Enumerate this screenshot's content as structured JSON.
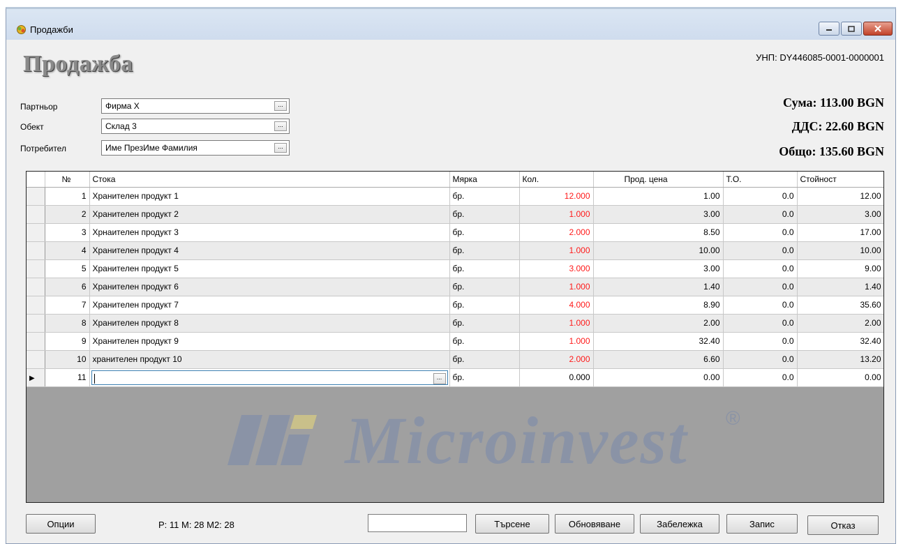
{
  "window": {
    "title": "Продажби",
    "controls": {
      "minimize": "minimize-icon",
      "maximize": "maximize-icon",
      "close": "close-icon"
    }
  },
  "header": {
    "title": "Продажба",
    "unp": "УНП: DY446085-0001-0000001"
  },
  "fields": [
    {
      "label": "Партньор",
      "value": "Фирма Х"
    },
    {
      "label": "Обект",
      "value": "Склад 3"
    },
    {
      "label": "Потребител",
      "value": "Име ПрезИме Фамилия"
    }
  ],
  "field_button": "...",
  "totals": {
    "sum": "Сума: 113.00 BGN",
    "vat": "ДДС: 22.60 BGN",
    "total": "Общо: 135.60 BGN"
  },
  "table": {
    "columns": [
      "№",
      "Стока",
      "Мярка",
      "Кол.",
      "Прод. цена",
      "Т.О.",
      "Стойност"
    ],
    "rows": [
      {
        "no": "1",
        "item": "Хранителен продукт 1",
        "unit": "бр.",
        "qty": "12.000",
        "price": "1.00",
        "to": "0.0",
        "value": "12.00"
      },
      {
        "no": "2",
        "item": "Хранителен продукт 2",
        "unit": "бр.",
        "qty": "1.000",
        "price": "3.00",
        "to": "0.0",
        "value": "3.00"
      },
      {
        "no": "3",
        "item": "Хрнаителен продукт 3",
        "unit": "бр.",
        "qty": "2.000",
        "price": "8.50",
        "to": "0.0",
        "value": "17.00"
      },
      {
        "no": "4",
        "item": "Хранителен продукт 4",
        "unit": "бр.",
        "qty": "1.000",
        "price": "10.00",
        "to": "0.0",
        "value": "10.00"
      },
      {
        "no": "5",
        "item": "Хранителен продукт 5",
        "unit": "бр.",
        "qty": "3.000",
        "price": "3.00",
        "to": "0.0",
        "value": "9.00"
      },
      {
        "no": "6",
        "item": "Хранителен продукт 6",
        "unit": "бр.",
        "qty": "1.000",
        "price": "1.40",
        "to": "0.0",
        "value": "1.40"
      },
      {
        "no": "7",
        "item": "Хранителен продукт 7",
        "unit": "бр.",
        "qty": "4.000",
        "price": "8.90",
        "to": "0.0",
        "value": "35.60"
      },
      {
        "no": "8",
        "item": "Хранителен продукт 8",
        "unit": "бр.",
        "qty": "1.000",
        "price": "2.00",
        "to": "0.0",
        "value": "2.00"
      },
      {
        "no": "9",
        "item": "Хранителен продукт 9",
        "unit": "бр.",
        "qty": "1.000",
        "price": "32.40",
        "to": "0.0",
        "value": "32.40"
      },
      {
        "no": "10",
        "item": "хранителен продукт 10",
        "unit": "бр.",
        "qty": "2.000",
        "price": "6.60",
        "to": "0.0",
        "value": "13.20"
      }
    ],
    "current_row": {
      "no": "11",
      "item": "",
      "unit": "бр.",
      "qty": "0.000",
      "price": "0.00",
      "to": "0.0",
      "value": "0.00"
    },
    "current_marker": "▶"
  },
  "watermark": {
    "text": "Microinvest",
    "reg": "®"
  },
  "footer": {
    "options": "Опции",
    "status": "P: 11   M: 28   M2: 28",
    "search_value": "",
    "search_button": "Търсене",
    "refresh_button": "Обновяване",
    "note_button": "Забележка",
    "save_button": "Запис",
    "cancel_button": "Отказ"
  },
  "colors": {
    "qty_red": "#ff1a1a",
    "title_bar": "#dbe6f3",
    "grid_bg": "#a0a0a0",
    "close_red": "#c2432a"
  }
}
